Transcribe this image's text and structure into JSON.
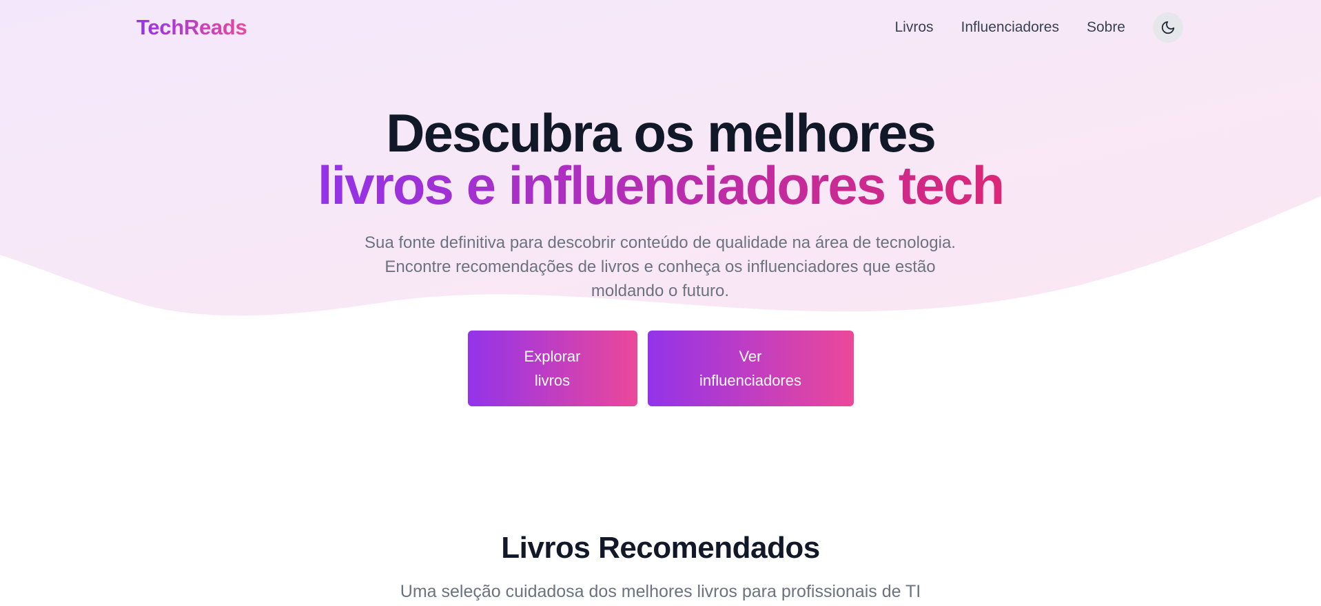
{
  "header": {
    "logo": "TechReads",
    "nav": [
      {
        "label": "Livros"
      },
      {
        "label": "Influenciadores"
      },
      {
        "label": "Sobre"
      }
    ],
    "theme_toggle_icon": "moon-icon"
  },
  "hero": {
    "title_line1": "Descubra os melhores",
    "title_line2": "livros e influenciadores tech",
    "subtitle_line1": "Sua fonte definitiva para descobrir conteúdo de qualidade na área de tecnologia.",
    "subtitle_line2": "Encontre recomendações de livros e conheça os influenciadores que estão",
    "subtitle_line3": "moldando o futuro.",
    "buttons": [
      {
        "line1": "Explorar",
        "line2": "livros"
      },
      {
        "line1": "Ver",
        "line2": "influenciadores"
      }
    ]
  },
  "books_section": {
    "title": "Livros Recomendados",
    "subtitle": "Uma seleção cuidadosa dos melhores livros para profissionais de TI"
  },
  "colors": {
    "gradient_start": "#9333ea",
    "gradient_end": "#ec4899",
    "hero_bg_start": "#f3e8fb",
    "hero_bg_end": "#fce7f3",
    "heading": "#111827",
    "muted_text": "#6b7280"
  }
}
